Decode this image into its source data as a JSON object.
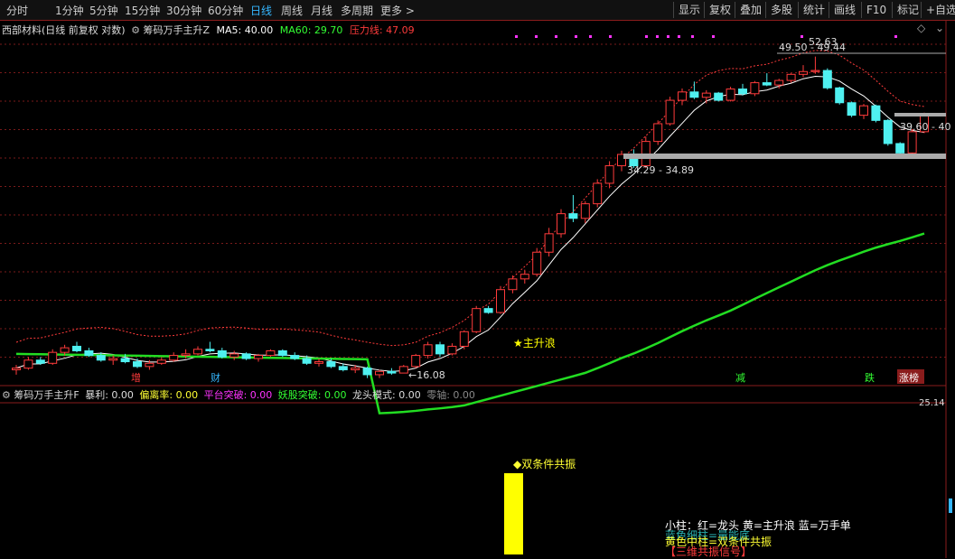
{
  "toolbar": {
    "periods": [
      "分时",
      "1分钟",
      "5分钟",
      "15分钟",
      "30分钟",
      "60分钟",
      "日线",
      "周线",
      "月线",
      "多周期",
      "更多"
    ],
    "active_period": "日线",
    "right_buttons": [
      "显示",
      "复权",
      "叠加",
      "多股",
      "统计",
      "画线",
      "F10",
      "标记",
      "+自选"
    ]
  },
  "main_chart": {
    "stock_title": "西部材料(日线 前复权 对数)",
    "indicator_name": "筹码万手主升Z",
    "ma5_label": "MA5: 40.00",
    "ma60_label": "MA60: 29.70",
    "pressure_label": "压力线: 47.09",
    "high_label": "52.63",
    "zone_upper_label": "49.50 - 49.44",
    "zone_right_label": "39.60 - 40",
    "zone_mid_label": "34.29 - 34.89",
    "low_label": "←16.08",
    "signal_label": "★主升浪",
    "event_markers": [
      "增",
      "财",
      "减",
      "跌",
      "涨榜"
    ],
    "colors": {
      "up": "#ff3b3b",
      "down": "#4ff0f0",
      "ma5": "#ffffff",
      "ma60": "#22dd22",
      "pressure": "#ff3b3b",
      "signal": "#ffff00",
      "dot": "#ff33ff"
    }
  },
  "sub_chart": {
    "indicator_name": "筹码万手主升F",
    "values": [
      {
        "label": "暴利: 0.00",
        "color": "#dddddd"
      },
      {
        "label": "偏离率: 0.00",
        "color": "#ffff33"
      },
      {
        "label": "平台突破: 0.00",
        "color": "#ff33ff"
      },
      {
        "label": "妖股突破: 0.00",
        "color": "#33ff33"
      },
      {
        "label": "龙头模式: 0.00",
        "color": "#dddddd"
      },
      {
        "label": "零轴: 0.00",
        "color": "#888888"
      }
    ],
    "scale_top": "25.14",
    "bar_annotation": "◆双条件共振",
    "legend_lines": [
      "小柱：红=龙头 黄=主升浪 蓝=万手单",
      "黄色中柱=双条件共振",
      "【三维共振信号】"
    ],
    "legend_overlap": "蓝色细柱=量能底"
  },
  "chart_data": {
    "type": "candlestick",
    "series": [
      {
        "name": "candles",
        "values": [
          [
            16.6,
            16.9,
            16.3,
            16.7
          ],
          [
            16.7,
            17.4,
            16.6,
            17.2
          ],
          [
            17.2,
            17.4,
            16.9,
            17.0
          ],
          [
            17.0,
            17.9,
            16.9,
            17.7
          ],
          [
            17.7,
            18.2,
            17.5,
            18.0
          ],
          [
            18.1,
            18.4,
            17.7,
            17.8
          ],
          [
            17.8,
            18.0,
            17.4,
            17.5
          ],
          [
            17.5,
            17.7,
            17.1,
            17.2
          ],
          [
            17.2,
            17.5,
            16.9,
            17.3
          ],
          [
            17.3,
            17.6,
            17.0,
            17.1
          ],
          [
            17.1,
            17.3,
            16.7,
            16.8
          ],
          [
            16.8,
            17.2,
            16.6,
            17.0
          ],
          [
            17.0,
            17.4,
            16.9,
            17.2
          ],
          [
            17.2,
            17.7,
            17.1,
            17.5
          ],
          [
            17.5,
            17.9,
            17.3,
            17.6
          ],
          [
            17.6,
            18.1,
            17.5,
            17.9
          ],
          [
            17.9,
            18.4,
            17.7,
            17.8
          ],
          [
            17.8,
            18.0,
            17.3,
            17.4
          ],
          [
            17.4,
            17.8,
            17.2,
            17.6
          ],
          [
            17.6,
            17.7,
            17.2,
            17.3
          ],
          [
            17.3,
            17.6,
            17.1,
            17.5
          ],
          [
            17.5,
            17.9,
            17.4,
            17.8
          ],
          [
            17.8,
            17.9,
            17.4,
            17.5
          ],
          [
            17.5,
            17.7,
            17.2,
            17.3
          ],
          [
            17.3,
            17.5,
            16.9,
            17.0
          ],
          [
            17.0,
            17.3,
            16.8,
            17.1
          ],
          [
            17.1,
            17.3,
            16.7,
            16.8
          ],
          [
            16.8,
            17.0,
            16.5,
            16.6
          ],
          [
            16.6,
            16.9,
            16.4,
            16.7
          ],
          [
            16.7,
            16.8,
            16.1,
            16.3
          ],
          [
            16.3,
            16.6,
            16.1,
            16.5
          ],
          [
            16.5,
            16.7,
            16.3,
            16.4
          ],
          [
            16.4,
            16.9,
            16.4,
            16.8
          ],
          [
            16.8,
            17.6,
            16.7,
            17.5
          ],
          [
            17.5,
            18.4,
            17.3,
            18.2
          ],
          [
            18.2,
            18.4,
            17.4,
            17.6
          ],
          [
            17.6,
            18.3,
            17.5,
            18.1
          ],
          [
            18.1,
            19.2,
            17.9,
            19.1
          ],
          [
            19.1,
            21.0,
            19.0,
            20.8
          ],
          [
            20.8,
            21.0,
            20.4,
            20.5
          ],
          [
            20.5,
            22.6,
            20.4,
            22.3
          ],
          [
            22.3,
            23.5,
            22.0,
            23.2
          ],
          [
            23.2,
            24.0,
            22.8,
            23.6
          ],
          [
            23.6,
            26.0,
            23.4,
            25.6
          ],
          [
            25.6,
            28.0,
            25.2,
            27.4
          ],
          [
            27.4,
            30.0,
            27.0,
            29.5
          ],
          [
            29.5,
            31.6,
            28.6,
            29.0
          ],
          [
            29.0,
            30.9,
            28.5,
            30.6
          ],
          [
            30.6,
            33.5,
            30.2,
            33.0
          ],
          [
            33.0,
            35.8,
            32.4,
            35.2
          ],
          [
            35.2,
            37.2,
            34.5,
            36.7
          ],
          [
            36.7,
            37.4,
            34.9,
            35.2
          ],
          [
            35.2,
            39.2,
            34.9,
            38.5
          ],
          [
            38.5,
            41.6,
            38.0,
            41.1
          ],
          [
            41.1,
            45.4,
            40.8,
            44.8
          ],
          [
            44.8,
            46.8,
            44.0,
            46.2
          ],
          [
            46.2,
            48.0,
            45.0,
            45.3
          ],
          [
            45.3,
            46.5,
            44.3,
            46.0
          ],
          [
            46.0,
            46.2,
            44.6,
            44.8
          ],
          [
            44.8,
            47.1,
            44.6,
            46.7
          ],
          [
            46.7,
            47.6,
            45.6,
            45.9
          ],
          [
            45.9,
            48.1,
            45.5,
            47.8
          ],
          [
            47.8,
            49.5,
            47.2,
            47.4
          ],
          [
            47.4,
            48.5,
            46.8,
            48.2
          ],
          [
            48.2,
            49.5,
            47.8,
            49.3
          ],
          [
            49.3,
            51.0,
            48.8,
            49.8
          ],
          [
            49.8,
            52.63,
            49.4,
            50.0
          ],
          [
            50.0,
            50.4,
            46.6,
            46.9
          ],
          [
            46.9,
            47.1,
            44.1,
            44.4
          ],
          [
            44.4,
            44.6,
            42.1,
            42.4
          ],
          [
            42.4,
            44.2,
            41.8,
            43.9
          ],
          [
            43.9,
            44.1,
            41.3,
            41.6
          ],
          [
            41.6,
            41.8,
            37.9,
            38.2
          ],
          [
            38.2,
            38.4,
            36.6,
            36.9
          ],
          [
            36.9,
            40.3,
            36.7,
            39.9
          ],
          [
            39.9,
            42.8,
            39.7,
            42.4
          ]
        ]
      }
    ],
    "y_scale": "log",
    "ylim": [
      15.4,
      56
    ]
  }
}
